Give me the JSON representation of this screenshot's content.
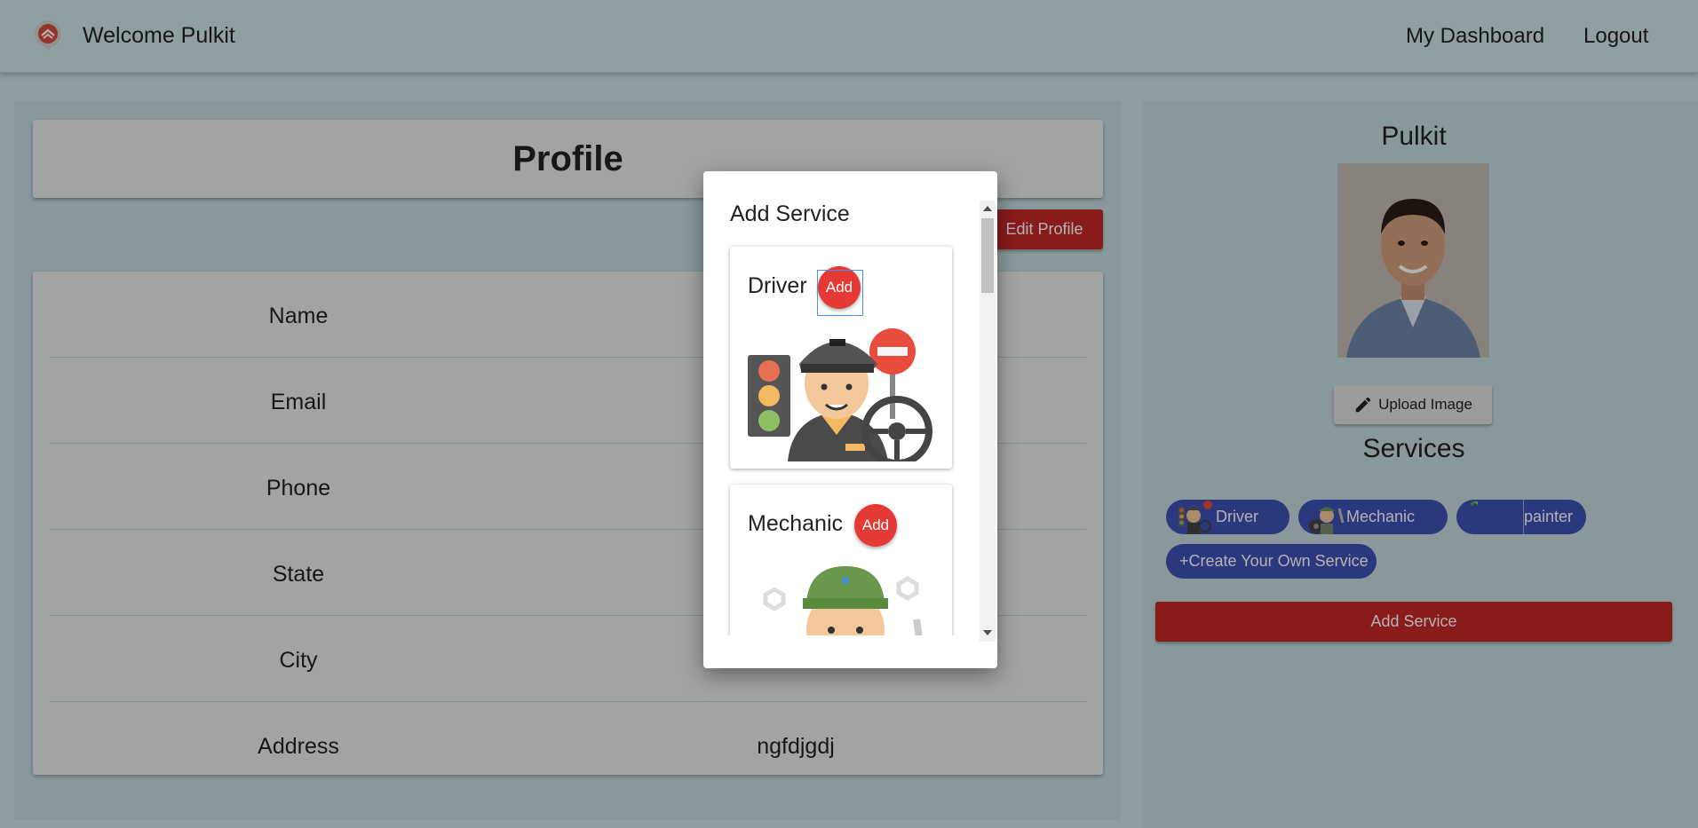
{
  "header": {
    "welcome": "Welcome Pulkit",
    "nav": [
      {
        "label": "My Dashboard"
      },
      {
        "label": "Logout"
      }
    ]
  },
  "profile": {
    "title": "Profile",
    "edit_label": "Edit Profile",
    "rows": [
      {
        "label": "Name",
        "value": ""
      },
      {
        "label": "Email",
        "value": ""
      },
      {
        "label": "Phone",
        "value": ""
      },
      {
        "label": "State",
        "value": ""
      },
      {
        "label": "City",
        "value": ""
      },
      {
        "label": "Address",
        "value": "ngfdjgdj"
      }
    ]
  },
  "sidebar": {
    "name": "Pulkit",
    "upload_label": "Upload Image",
    "services_title": "Services",
    "chips": [
      {
        "label": "Driver"
      },
      {
        "label": "Mechanic"
      },
      {
        "label": "painter"
      },
      {
        "label": "+Create Your Own Service"
      }
    ],
    "add_service_label": "Add Service"
  },
  "dialog": {
    "title": "Add Service",
    "cards": [
      {
        "name": "Driver",
        "add_label": "Add"
      },
      {
        "name": "Mechanic",
        "add_label": "Add"
      }
    ]
  },
  "colors": {
    "accent_red": "#c62828",
    "chip_blue": "#3f51b5",
    "add_circle": "#e53935"
  }
}
